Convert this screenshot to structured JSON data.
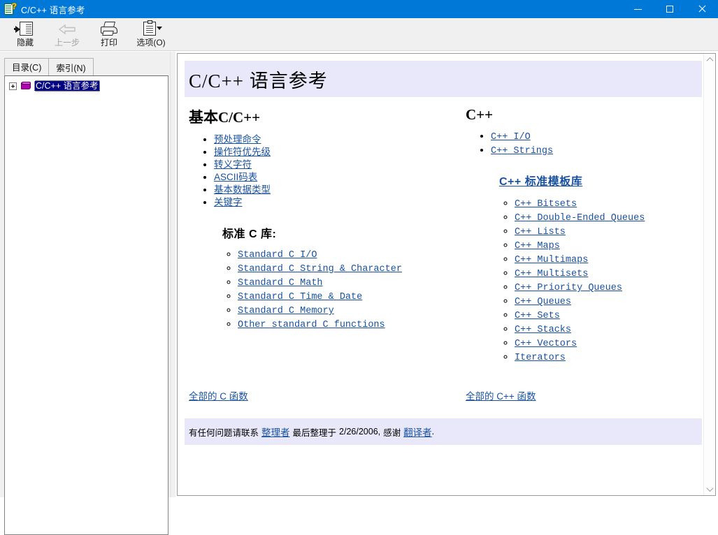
{
  "window": {
    "title": "C/C++ 语言参考",
    "app_icon": "help-document-icon",
    "minimize_label": "最小化",
    "maximize_label": "最大化",
    "close_label": "关闭"
  },
  "toolbar": {
    "buttons": [
      {
        "label": "隐藏",
        "icon": "hide-pane-icon",
        "enabled": true
      },
      {
        "label": "上一步",
        "icon": "back-arrow-icon",
        "enabled": false
      },
      {
        "label": "打印",
        "icon": "printer-icon",
        "enabled": true
      },
      {
        "label": "选项",
        "accel": "(O)",
        "icon": "options-clipboard-icon",
        "enabled": true
      }
    ],
    "options_full_label": "选项(O)"
  },
  "sidebar": {
    "tabs": [
      {
        "label_pre": "目录",
        "label_accel": "C",
        "label_post": ")",
        "full": "目录(C)",
        "active": true
      },
      {
        "label_pre": "索引",
        "label_accel": "N",
        "label_post": ")",
        "full": "索引(N)",
        "active": false
      }
    ],
    "tree": {
      "expander": "+",
      "node_icon": "book-icon",
      "node_label": "C/C++ 语言参考",
      "selected": true
    }
  },
  "content": {
    "title": "C/C++  语言参考",
    "left_column": {
      "heading": "基本C/C++",
      "links": [
        "预处理命令",
        "操作符优先级",
        "转义字符",
        "ASCII码表",
        "基本数据类型",
        "关键字"
      ],
      "sub_heading": "标准 C 库:",
      "sub_links": [
        "Standard C I/O",
        "Standard C String & Character",
        "Standard C Math",
        "Standard C Time & Date",
        "Standard C Memory",
        "Other standard C functions"
      ]
    },
    "right_column": {
      "heading": "C++",
      "links": [
        "C++ I/O",
        "C++ Strings"
      ],
      "stl_title": "C++ 标准模板库",
      "stl_links": [
        "C++ Bitsets",
        "C++ Double-Ended Queues",
        "C++ Lists",
        "C++ Maps",
        "C++ Multimaps",
        "C++ Multisets",
        "C++ Priority Queues",
        "C++ Queues",
        "C++ Sets",
        "C++ Stacks",
        "C++ Vectors",
        "Iterators"
      ]
    },
    "all_functions": {
      "c_label": "全部的 C 函数",
      "cpp_label": "全部的 C++ 函数"
    },
    "footer": {
      "text_1": "有任何问题请联系",
      "link_1": "整理者",
      "text_2": "最后整理于",
      "date": "2/26/2006,",
      "text_3": "感谢",
      "link_2": "翻译者",
      "text_4": "."
    }
  },
  "scrollbar": {
    "up_arrow": "chevron-up-icon",
    "down_arrow": "chevron-down-icon"
  },
  "colors": {
    "titlebar": "#0078d7",
    "band": "#e8e8fa",
    "link": "#19519e",
    "selection": "#000080"
  }
}
